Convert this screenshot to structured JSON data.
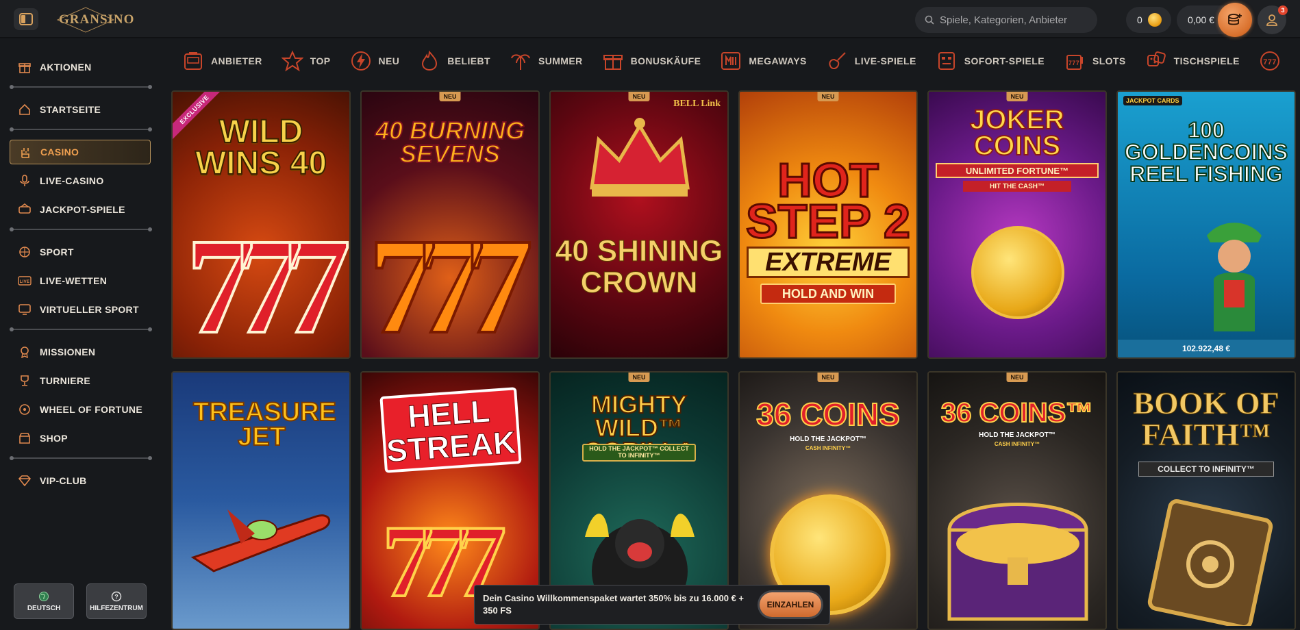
{
  "header": {
    "logo_text": "GRANSINO",
    "search_placeholder": "Spiele, Kategorien, Anbieter",
    "coins": "0",
    "balance": "0,00 €",
    "notification_count": "3"
  },
  "sidebar": {
    "items": [
      {
        "label": "AKTIONEN",
        "icon": "gift-icon"
      },
      {
        "label": "STARTSEITE",
        "icon": "home-icon"
      },
      {
        "label": "CASINO",
        "icon": "rock-hand-icon",
        "active": true
      },
      {
        "label": "LIVE-CASINO",
        "icon": "microphone-icon"
      },
      {
        "label": "JACKPOT-SPIELE",
        "icon": "jackpot-icon"
      },
      {
        "label": "SPORT",
        "icon": "basketball-icon"
      },
      {
        "label": "LIVE-WETTEN",
        "icon": "live-icon"
      },
      {
        "label": "VIRTUELLER SPORT",
        "icon": "monitor-icon"
      },
      {
        "label": "MISSIONEN",
        "icon": "medal-icon"
      },
      {
        "label": "TURNIERE",
        "icon": "trophy-icon"
      },
      {
        "label": "WHEEL OF FORTUNE",
        "icon": "wheel-icon"
      },
      {
        "label": "SHOP",
        "icon": "shop-icon"
      },
      {
        "label": "VIP-CLUB",
        "icon": "diamond-icon"
      }
    ],
    "language_label": "DEUTSCH",
    "help_label": "HILFEZENTRUM"
  },
  "categories": [
    {
      "label": "ANBIETER",
      "icon": "slot-machine-icon"
    },
    {
      "label": "TOP",
      "icon": "star-icon"
    },
    {
      "label": "NEU",
      "icon": "lightning-icon"
    },
    {
      "label": "BELIEBT",
      "icon": "flame-icon"
    },
    {
      "label": "SUMMER",
      "icon": "palm-icon"
    },
    {
      "label": "BONUSKÄUFE",
      "icon": "gift-box-icon"
    },
    {
      "label": "MEGAWAYS",
      "icon": "megaways-icon"
    },
    {
      "label": "LIVE-SPIELE",
      "icon": "guitar-icon"
    },
    {
      "label": "SOFORT-SPIELE",
      "icon": "tiki-icon"
    },
    {
      "label": "SLOTS",
      "icon": "slots-icon"
    },
    {
      "label": "TISCHSPIELE",
      "icon": "dice-icon"
    }
  ],
  "games": [
    {
      "title": "WILD WINS 40",
      "badge": "EXCLUSIVE"
    },
    {
      "title": "40 BURNING SEVENS",
      "badge": "NEU"
    },
    {
      "title": "40 SHINING CROWN",
      "badge": "NEU",
      "sub": "BELL Link"
    },
    {
      "title": "HOT STEP 2",
      "sub": "EXTREME",
      "sub2": "HOLD AND WIN",
      "badge": "NEU"
    },
    {
      "title": "JOKER COINS",
      "sub": "UNLIMITED FORTUNE™",
      "sub2": "HIT THE CASH™",
      "badge": "NEU"
    },
    {
      "title": "100 GOLDENCOINS REEL FISHING",
      "jackpot": "102.922,48 €",
      "brand": "JACKPOT CARDS"
    },
    {
      "title": "TREASURE JET"
    },
    {
      "title": "HELL STREAK"
    },
    {
      "title": "MIGHTY WILD™ GORILLA",
      "sub": "HOLD THE JACKPOT™ COLLECT TO INFINITY™",
      "badge": "NEU"
    },
    {
      "title": "36 COINS",
      "sub": "HOLD THE JACKPOT™",
      "sub2": "CASH INFINITY™",
      "badge": "NEU"
    },
    {
      "title": "36 COINS™",
      "sub": "HOLD THE JACKPOT™",
      "sub2": "CASH INFINITY™",
      "badge": "NEU"
    },
    {
      "title": "BOOK OF FAITH™",
      "sub": "COLLECT TO INFINITY™"
    }
  ],
  "promo": {
    "text": "Dein Casino Willkommenspaket wartet 350% bis zu 16.000 € + 350 FS",
    "button": "EINZAHLEN"
  }
}
